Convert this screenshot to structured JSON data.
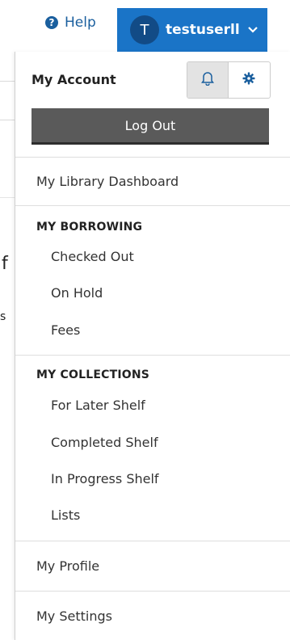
{
  "header": {
    "help_label": "Help",
    "help_icon": "?",
    "avatar_initial": "T",
    "username": "testuserll",
    "chevron": "⌄"
  },
  "account": {
    "title": "My Account",
    "logout_label": "Log Out"
  },
  "menu": {
    "dashboard": "My Library Dashboard",
    "borrowing_heading": "MY BORROWING",
    "checked_out": "Checked Out",
    "on_hold": "On Hold",
    "fees": "Fees",
    "collections_heading": "MY COLLECTIONS",
    "for_later": "For Later Shelf",
    "completed": "Completed Shelf",
    "in_progress": "In Progress Shelf",
    "lists": "Lists",
    "profile": "My Profile",
    "settings": "My Settings"
  },
  "colors": {
    "brand_blue": "#1a74c7",
    "link_blue": "#1a5f9e",
    "logout_bg": "#5a5a5a"
  },
  "icons": {
    "help": "help-icon",
    "notifications": "bell-icon",
    "settings": "gear-icon",
    "dropdown": "chevron-down-icon"
  }
}
